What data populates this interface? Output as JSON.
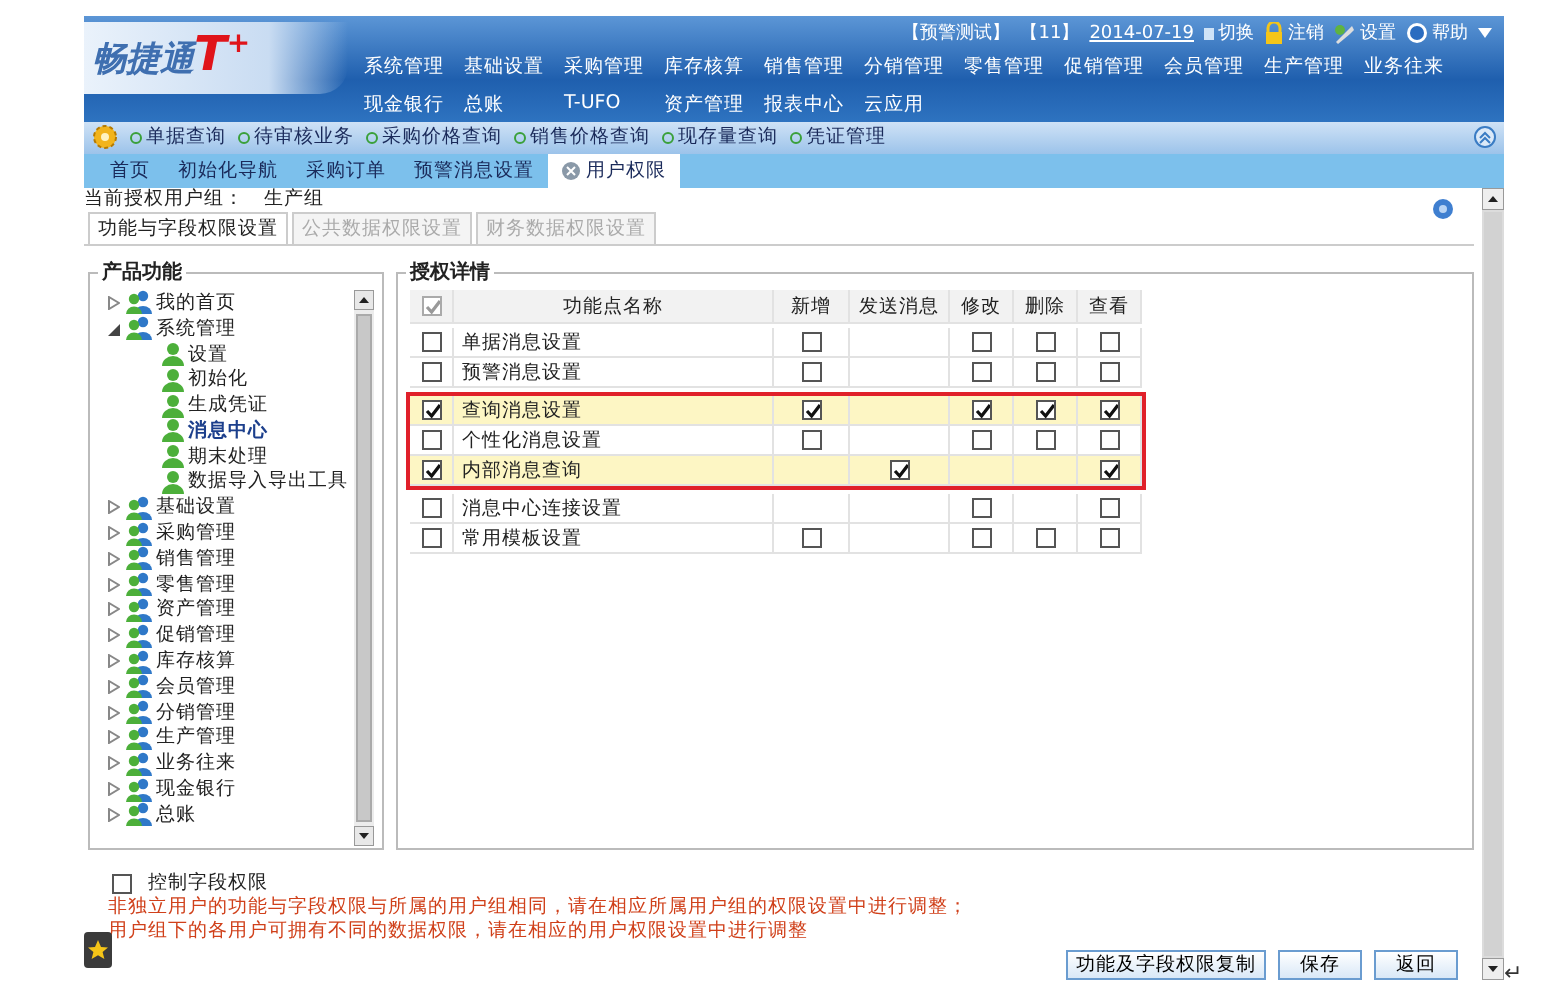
{
  "header": {
    "logo": {
      "name": "畅捷通",
      "mark": "T$^{+}$"
    },
    "account": "【预警测试】",
    "period": "【11】",
    "date": "2014-07-19",
    "actions": [
      {
        "label": "切换",
        "kind": "switch"
      },
      {
        "label": "注销",
        "kind": "lock"
      },
      {
        "label": "设置",
        "kind": "settings"
      },
      {
        "label": "帮助",
        "kind": "help"
      }
    ],
    "menu_rows": [
      [
        "系统管理",
        "基础设置",
        "采购管理",
        "库存核算",
        "销售管理",
        "分销管理",
        "零售管理",
        "促销管理",
        "会员管理",
        "生产管理",
        "业务往来"
      ],
      [
        "现金银行",
        "总账",
        "T-UFO",
        "资产管理",
        "报表中心",
        "云应用"
      ]
    ]
  },
  "quick_bar": {
    "links": [
      "单据查询",
      "待审核业务",
      "采购价格查询",
      "销售价格查询",
      "现存量查询",
      "凭证管理"
    ]
  },
  "tabs": [
    {
      "label": "首页",
      "selected": false,
      "closable": false
    },
    {
      "label": "初始化导航",
      "selected": false,
      "closable": false
    },
    {
      "label": "采购订单",
      "selected": false,
      "closable": false
    },
    {
      "label": "预警消息设置",
      "selected": false,
      "closable": false
    },
    {
      "label": "用户权限",
      "selected": true,
      "closable": true
    }
  ],
  "current_group": {
    "label": "当前授权用户组：",
    "value": "生产组"
  },
  "sub_tabs": [
    {
      "label": "功能与字段权限设置",
      "selected": true
    },
    {
      "label": "公共数据权限设置",
      "selected": false
    },
    {
      "label": "财务数据权限设置",
      "selected": false
    }
  ],
  "tree": {
    "title": "产品功能",
    "items": [
      {
        "label": "我的首页",
        "kind": "group",
        "expanded": false,
        "selected": false
      },
      {
        "label": "系统管理",
        "kind": "group",
        "expanded": true,
        "selected": false,
        "children": [
          {
            "label": "设置",
            "kind": "item",
            "selected": false
          },
          {
            "label": "初始化",
            "kind": "item",
            "selected": false
          },
          {
            "label": "生成凭证",
            "kind": "item",
            "selected": false
          },
          {
            "label": "消息中心",
            "kind": "item",
            "selected": true
          },
          {
            "label": "期末处理",
            "kind": "item",
            "selected": false
          },
          {
            "label": "数据导入导出工具",
            "kind": "item",
            "selected": false
          }
        ]
      },
      {
        "label": "基础设置",
        "kind": "group",
        "expanded": false,
        "selected": false
      },
      {
        "label": "采购管理",
        "kind": "group",
        "expanded": false,
        "selected": false
      },
      {
        "label": "销售管理",
        "kind": "group",
        "expanded": false,
        "selected": false
      },
      {
        "label": "零售管理",
        "kind": "group",
        "expanded": false,
        "selected": false
      },
      {
        "label": "资产管理",
        "kind": "group",
        "expanded": false,
        "selected": false
      },
      {
        "label": "促销管理",
        "kind": "group",
        "expanded": false,
        "selected": false
      },
      {
        "label": "库存核算",
        "kind": "group",
        "expanded": false,
        "selected": false
      },
      {
        "label": "会员管理",
        "kind": "group",
        "expanded": false,
        "selected": false
      },
      {
        "label": "分销管理",
        "kind": "group",
        "expanded": false,
        "selected": false
      },
      {
        "label": "生产管理",
        "kind": "group",
        "expanded": false,
        "selected": false
      },
      {
        "label": "业务往来",
        "kind": "group",
        "expanded": false,
        "selected": false
      },
      {
        "label": "现金银行",
        "kind": "group",
        "expanded": false,
        "selected": false
      },
      {
        "label": "总账",
        "kind": "group",
        "expanded": false,
        "selected": false
      }
    ]
  },
  "details": {
    "title": "授权详情",
    "header_checked": true,
    "columns": [
      "功能点名称",
      "新增",
      "发送消息",
      "修改",
      "删除",
      "查看"
    ],
    "rows": [
      {
        "checked": false,
        "name": "单据消息设置",
        "in_highlight": false,
        "perms": [
          {
            "kind": "check",
            "checked": false
          },
          {
            "kind": "blank"
          },
          {
            "kind": "check",
            "checked": false
          },
          {
            "kind": "check",
            "checked": false
          },
          {
            "kind": "check",
            "checked": false
          }
        ]
      },
      {
        "checked": false,
        "name": "预警消息设置",
        "in_highlight": false,
        "perms": [
          {
            "kind": "check",
            "checked": false
          },
          {
            "kind": "blank"
          },
          {
            "kind": "check",
            "checked": false
          },
          {
            "kind": "check",
            "checked": false
          },
          {
            "kind": "check",
            "checked": false
          }
        ]
      },
      {
        "checked": true,
        "name": "查询消息设置",
        "in_highlight": true,
        "perms": [
          {
            "kind": "check",
            "checked": true
          },
          {
            "kind": "blank"
          },
          {
            "kind": "check",
            "checked": true
          },
          {
            "kind": "check",
            "checked": true
          },
          {
            "kind": "check",
            "checked": true
          }
        ]
      },
      {
        "checked": false,
        "name": "个性化消息设置",
        "in_highlight": true,
        "perms": [
          {
            "kind": "check",
            "checked": false
          },
          {
            "kind": "blank"
          },
          {
            "kind": "check",
            "checked": false
          },
          {
            "kind": "check",
            "checked": false
          },
          {
            "kind": "check",
            "checked": false
          }
        ]
      },
      {
        "checked": true,
        "name": "内部消息查询",
        "in_highlight": true,
        "perms": [
          {
            "kind": "blank"
          },
          {
            "kind": "check",
            "checked": true
          },
          {
            "kind": "blank"
          },
          {
            "kind": "blank"
          },
          {
            "kind": "check",
            "checked": true
          }
        ]
      },
      {
        "checked": false,
        "name": "消息中心连接设置",
        "in_highlight": false,
        "perms": [
          {
            "kind": "blank"
          },
          {
            "kind": "blank"
          },
          {
            "kind": "check",
            "checked": false
          },
          {
            "kind": "blank"
          },
          {
            "kind": "check",
            "checked": false
          }
        ]
      },
      {
        "checked": false,
        "name": "常用模板设置",
        "in_highlight": false,
        "perms": [
          {
            "kind": "check",
            "checked": false
          },
          {
            "kind": "blank"
          },
          {
            "kind": "check",
            "checked": false
          },
          {
            "kind": "check",
            "checked": false
          },
          {
            "kind": "check",
            "checked": false
          }
        ]
      }
    ]
  },
  "field_control": {
    "label": "控制字段权限",
    "checked": false
  },
  "notes": [
    "非独立用户的功能与字段权限与所属的用户组相同，请在相应所属用户组的权限设置中进行调整；",
    "用户组下的各用户可拥有不同的数据权限，请在相应的用户权限设置中进行调整"
  ],
  "buttons": [
    "功能及字段权限复制",
    "保存",
    "返回"
  ],
  "trailing_mark": "↵"
}
